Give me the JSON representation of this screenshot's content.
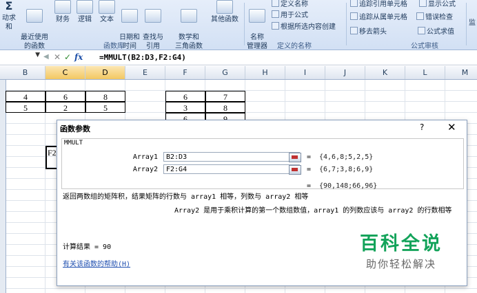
{
  "ribbon": {
    "autosum_label": "动求和",
    "recent_label": "最近使用\n的函数",
    "finance_label": "财务",
    "logic_label": "逻辑",
    "text_label": "文本",
    "datetime_label": "日期和\n时间",
    "lookup_label": "查找与\n引用",
    "math_label": "数学和\n三角函数",
    "other_label": "其他函数",
    "group_function_library": "函数库",
    "name_manager_label": "名称\n管理器",
    "define_name": "定义名称",
    "use_in_formula": "用于公式",
    "create_from_selection": "根据所选内容创建",
    "group_defined_names": "定义的名称",
    "trace_precedents": "追踪引用单元格",
    "trace_dependents": "追踪从属单元格",
    "remove_arrows": "移去箭头",
    "show_formulas": "显示公式",
    "error_checking": "错误检查",
    "evaluate_formula": "公式求值",
    "watch_window": "监",
    "group_formula_auditing": "公式审核"
  },
  "formula_bar": {
    "fx": "fx",
    "formula": "=MMULT(B2:D3,F2:G4)"
  },
  "grid": {
    "columns": [
      "B",
      "C",
      "D",
      "E",
      "F",
      "G",
      "H",
      "I",
      "J",
      "K",
      "L",
      "M"
    ],
    "selected_columns": [
      "C",
      "D"
    ],
    "matrix_a": [
      [
        "4",
        "6",
        "8"
      ],
      [
        "5",
        "2",
        "5"
      ]
    ],
    "matrix_b": [
      [
        "6",
        "7"
      ],
      [
        "3",
        "8"
      ],
      [
        "6",
        "9"
      ]
    ],
    "active_cell_text": "F2"
  },
  "dialog": {
    "title": "函数参数",
    "help_glyph": "?",
    "close_glyph": "✕",
    "function_name": "MMULT",
    "args": [
      {
        "label": "Array1",
        "value": "B2:D3",
        "result": "{4,6,8;5,2,5}"
      },
      {
        "label": "Array2",
        "value": "F2:G4",
        "result": "{6,7;3,8;6,9}"
      }
    ],
    "overall_result": "{90,148;66,96}",
    "equals": "=",
    "description": "返回两数组的矩阵积，结果矩阵的行数与 array1 相等，列数与 array2 相等",
    "arg_description": "Array2  是用于乘积计算的第一个数组数值，array1 的列数应该与 array2 的行数相等",
    "calc_result_label": "计算结果 =  90",
    "help_link": "有关该函数的帮助(H)"
  },
  "watermark": {
    "title": "百科全说",
    "subtitle": "助你轻松解决"
  }
}
